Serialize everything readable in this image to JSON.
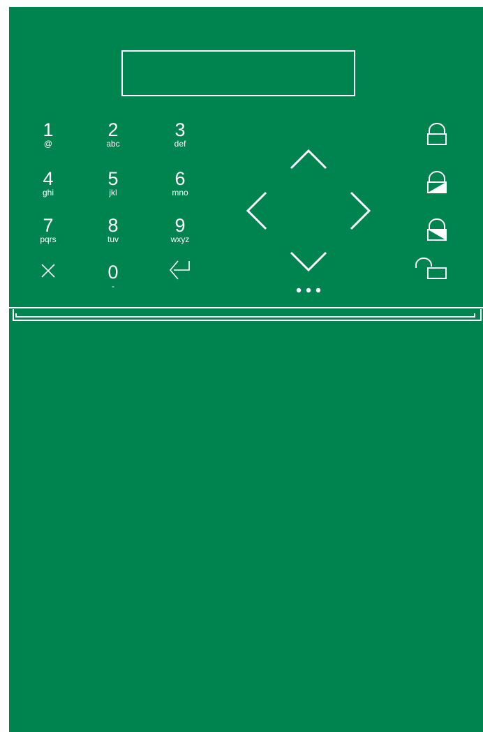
{
  "panel": {
    "background_color": "#00844f",
    "line_color": "#ffffff",
    "display_text": ""
  },
  "keys": [
    {
      "num": "1",
      "sub": "@"
    },
    {
      "num": "2",
      "sub": "abc"
    },
    {
      "num": "3",
      "sub": "def"
    },
    {
      "num": "4",
      "sub": "ghi"
    },
    {
      "num": "5",
      "sub": "jkl"
    },
    {
      "num": "6",
      "sub": "mno"
    },
    {
      "num": "7",
      "sub": "pqrs"
    },
    {
      "num": "8",
      "sub": "tuv"
    },
    {
      "num": "9",
      "sub": "wxyz"
    },
    {
      "num": "0",
      "sub": "-"
    }
  ],
  "icons": {
    "cancel": "close-icon",
    "enter": "enter-icon",
    "nav_up": "chevron-up-icon",
    "nav_down": "chevron-down-icon",
    "nav_left": "chevron-left-icon",
    "nav_right": "chevron-right-icon",
    "menu": "more-dots-icon",
    "arm_full": "lock-closed-icon",
    "arm_partial": "lock-half-icon",
    "arm_night": "lock-partial-icon",
    "disarm": "lock-open-icon"
  }
}
